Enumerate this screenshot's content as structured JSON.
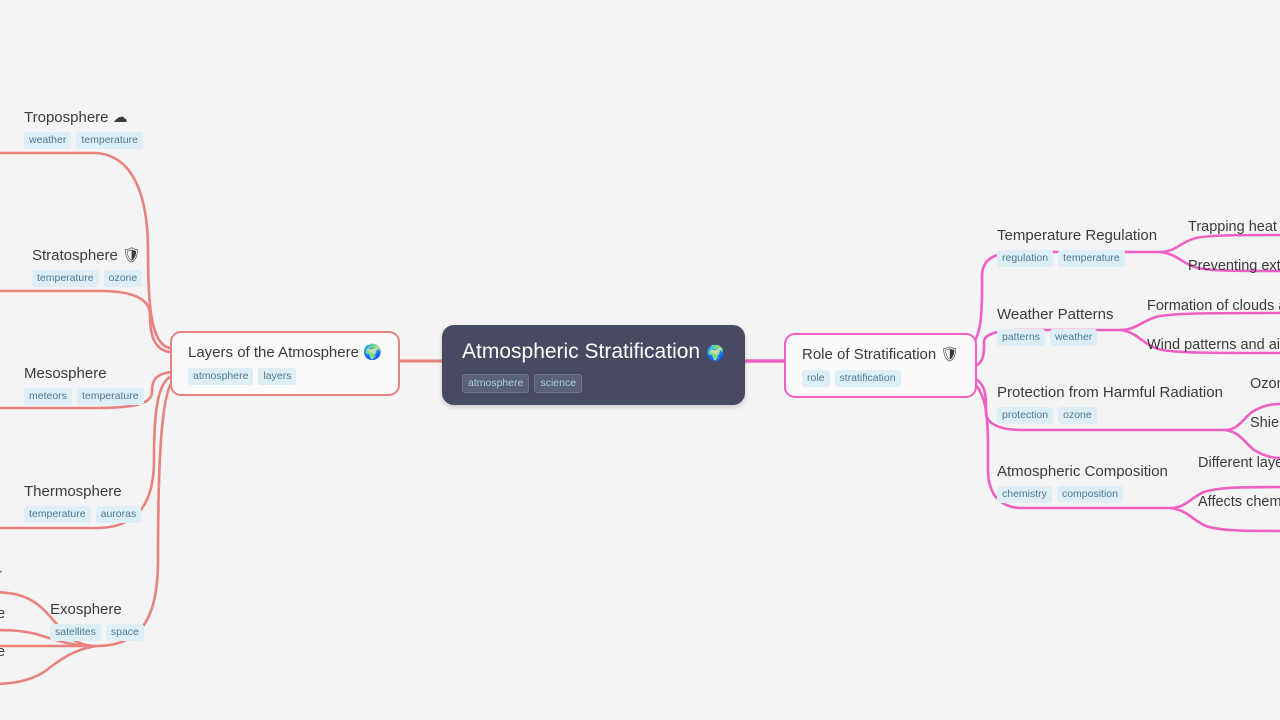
{
  "canvas": {
    "background": "#f4f4f4",
    "left_branch_color": "#e8827f",
    "right_branch_color": "#ef5fc4",
    "root_color": "#474a61",
    "tag_bg": "#ddeef7",
    "tag_text": "#4c7b94"
  },
  "root": {
    "title": "Atmospheric Stratification",
    "icon": "🌍",
    "icon_name": "earth-globe-icon",
    "tags": [
      "atmosphere",
      "science"
    ]
  },
  "left_branch": {
    "title": "Layers of the Atmosphere",
    "icon": "🌍",
    "icon_name": "earth-globe-icon",
    "tags": [
      "atmosphere",
      "layers"
    ],
    "children": [
      {
        "title": "Troposphere",
        "icon": "☁",
        "icon_name": "cloud-icon",
        "tags": [
          "weather",
          "temperature"
        ]
      },
      {
        "title": "Stratosphere",
        "icon": "🛡",
        "icon_name": "shield-icon",
        "tags": [
          "temperature",
          "ozone"
        ]
      },
      {
        "title": "Mesosphere",
        "icon": "",
        "icon_name": "",
        "tags": [
          "meteors",
          "temperature"
        ]
      },
      {
        "title": "Thermosphere",
        "icon": "",
        "icon_name": "",
        "tags": [
          "temperature",
          "auroras"
        ]
      },
      {
        "title": "Exosphere",
        "icon": "",
        "icon_name": "",
        "tags": [
          "satellites",
          "space"
        ]
      }
    ],
    "clipped_leaves": [
      {
        "title": "r"
      },
      {
        "title": "e"
      },
      {
        "title": "e"
      }
    ]
  },
  "right_branch": {
    "title": "Role of Stratification",
    "icon": "🛡",
    "icon_name": "shield-icon",
    "tags": [
      "role",
      "stratification"
    ],
    "children": [
      {
        "title": "Temperature Regulation",
        "tags": [
          "regulation",
          "temperature"
        ],
        "children": [
          {
            "title": "Trapping heat i"
          },
          {
            "title": "Preventing extr"
          }
        ]
      },
      {
        "title": "Weather Patterns",
        "tags": [
          "patterns",
          "weather"
        ],
        "children": [
          {
            "title": "Formation of clouds a"
          },
          {
            "title": "Wind patterns and air "
          }
        ]
      },
      {
        "title": "Protection from Harmful Radiation",
        "tags": [
          "protection",
          "ozone"
        ],
        "children": [
          {
            "title": "Ozon"
          },
          {
            "title": "Shiel"
          }
        ]
      },
      {
        "title": "Atmospheric Composition",
        "tags": [
          "chemistry",
          "composition"
        ],
        "children": [
          {
            "title": "Different laye"
          },
          {
            "title": "Affects chemi"
          }
        ]
      }
    ]
  }
}
